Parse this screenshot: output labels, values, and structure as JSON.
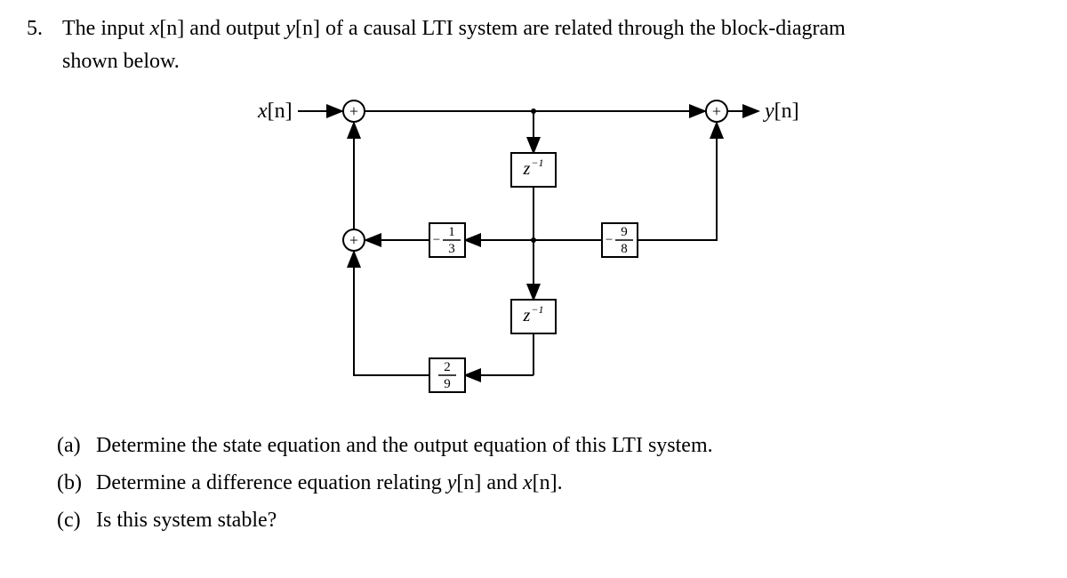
{
  "problem": {
    "number": "5.",
    "text_a": "The input ",
    "sym_x": "x",
    "br_n1": "[n]",
    "text_b": " and output ",
    "sym_y": "y",
    "br_n2": "[n]",
    "text_c": " of a causal LTI system are related through the block-diagram",
    "text_d": "shown below."
  },
  "diagram": {
    "input": {
      "sym": "x",
      "bracket": "[n]"
    },
    "output": {
      "sym": "y",
      "bracket": "[n]"
    },
    "delay_label_base": "z",
    "delay_label_exp": "−1",
    "gain1": {
      "num": "1",
      "den": "3",
      "sign": "−"
    },
    "gain2": {
      "num": "9",
      "den": "8",
      "sign": "−"
    },
    "gain3": {
      "num": "2",
      "den": "9",
      "sign": ""
    },
    "sum": "+"
  },
  "parts": {
    "a": {
      "l": "(a)",
      "t_a": "Determine the state equation and the output equation of this LTI system."
    },
    "b": {
      "l": "(b)",
      "t_a": "Determine a difference equation relating ",
      "sym_y": "y",
      "br1": "[n]",
      "t_b": " and ",
      "sym_x": "x",
      "br2": "[n]",
      "t_c": "."
    },
    "c": {
      "l": "(c)",
      "t_a": "Is this system stable?"
    }
  }
}
